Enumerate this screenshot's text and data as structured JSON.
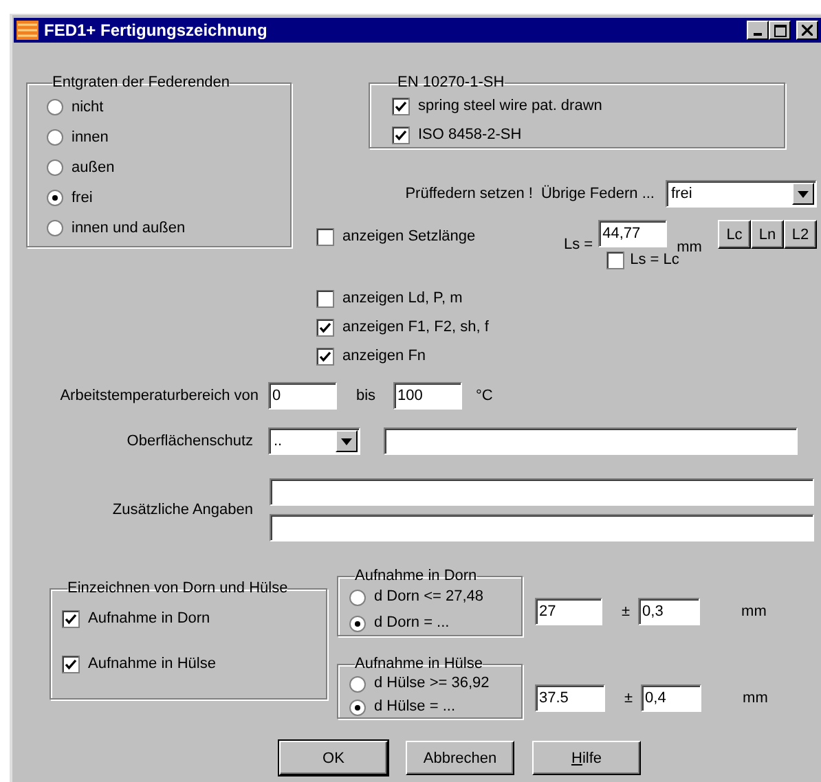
{
  "window": {
    "title": "FED1+ Fertigungszeichnung"
  },
  "deburring_group": {
    "title": "Entgraten der Federenden",
    "options": [
      {
        "label": "nicht",
        "selected": false
      },
      {
        "label": "innen",
        "selected": false
      },
      {
        "label": "außen",
        "selected": false
      },
      {
        "label": "frei",
        "selected": true
      },
      {
        "label": "innen und außen",
        "selected": false
      }
    ]
  },
  "material_group": {
    "title": "EN 10270-1-SH",
    "options": [
      {
        "label": "spring steel wire pat. drawn",
        "checked": true
      },
      {
        "label": "ISO 8458-2-SH",
        "checked": true
      }
    ]
  },
  "set_row": {
    "label_1": "Prüffedern setzen !",
    "label_2": "Übrige Federn ...",
    "combo_value": "frei"
  },
  "set_length": {
    "show": {
      "label": "anzeigen Setzlänge",
      "checked": false
    },
    "ls_label": "Ls =",
    "ls_value": "44,77",
    "unit": "mm",
    "ls_eq_lc": {
      "label": "Ls = Lc",
      "checked": false
    },
    "buttons": [
      "Lc",
      "Ln",
      "L2"
    ]
  },
  "display_options": [
    {
      "label": "anzeigen Ld, P, m",
      "checked": false
    },
    {
      "label": "anzeigen F1, F2, sh, f",
      "checked": true
    },
    {
      "label": "anzeigen Fn",
      "checked": true
    }
  ],
  "temperature": {
    "label": "Arbeitstemperaturbereich von",
    "from": "0",
    "to_label": "bis",
    "to": "100",
    "unit": "°C"
  },
  "surface": {
    "label": "Oberflächenschutz",
    "combo_value": ".."
  },
  "additional": {
    "label": "Zusätzliche Angaben"
  },
  "drawing_group": {
    "title": "Einzeichnen von Dorn und Hülse",
    "options": [
      {
        "label": "Aufnahme in Dorn",
        "checked": true
      },
      {
        "label": "Aufnahme in Hülse",
        "checked": true
      }
    ]
  },
  "fits": [
    {
      "title": "Aufnahme in Dorn",
      "options": [
        {
          "label": "d Dorn <= 27,48",
          "selected": false
        },
        {
          "label": "d Dorn = ...",
          "selected": true
        }
      ],
      "value": "27",
      "pm": "±",
      "tolerance": "0,3",
      "unit": "mm"
    },
    {
      "title": "Aufnahme in Hülse",
      "options": [
        {
          "label": "d Hülse >= 36,92",
          "selected": false
        },
        {
          "label": "d Hülse = ...",
          "selected": true
        }
      ],
      "value": "37.5",
      "pm": "±",
      "tolerance": "0,4",
      "unit": "mm"
    }
  ],
  "buttons": [
    {
      "label": "OK",
      "default": true,
      "underline_first": false
    },
    {
      "label": "Abbrechen",
      "default": false,
      "underline_first": false
    },
    {
      "label": "Hilfe",
      "default": false,
      "underline_first": true
    }
  ]
}
